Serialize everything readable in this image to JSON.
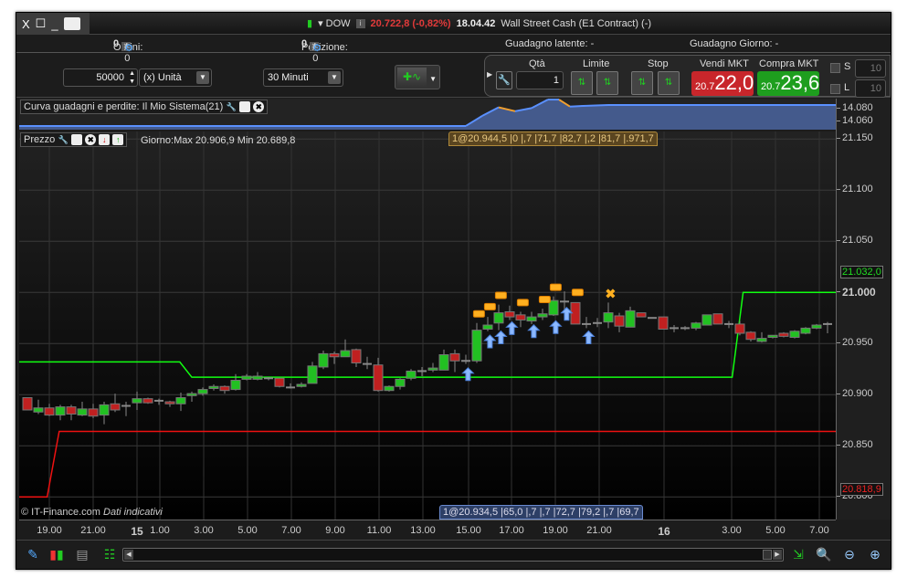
{
  "window": {
    "controls": [
      "X",
      "☐",
      "_"
    ],
    "symbol": "DOW",
    "price": "20.722,8 (-0,82%)",
    "time": "18.04.42",
    "instrument": "Wall Street Cash (E1 Contract) (-)"
  },
  "infobar": {
    "orders_label": "Ordini:",
    "orders_count": "0",
    "orders_sep": "/ 0",
    "position_label": "Posizione:",
    "position_count": "0",
    "position_sep": "/ 0",
    "latent_gain": "Guadagno latente: -",
    "day_gain": "Guadagno Giorno: -"
  },
  "orderbar": {
    "quantity": "50000",
    "unit": "(x) Unità",
    "timeframe": "30 Minuti",
    "qty_label": "Qtà",
    "qty_value": "1",
    "limit_label": "Limite",
    "stop_label": "Stop",
    "sell_label": "Vendi MKT",
    "sell_prefix": "20.7",
    "sell_price": "22,0",
    "buy_label": "Compra MKT",
    "buy_prefix": "20.7",
    "buy_price": "23,6",
    "s_label": "S",
    "s_value": "10",
    "l_label": "L",
    "l_value": "10"
  },
  "colors": {
    "sell": "#c8262b",
    "buy": "#1e9e1e",
    "up": "#22c022",
    "down": "#c02020",
    "equity": "#4a7fd8"
  },
  "equity_panel": {
    "title": "Curva guadagni e perdite: Il Mio Sistema(21)",
    "axis": [
      "14.080",
      "14.060"
    ]
  },
  "price_panel": {
    "title": "Prezzo",
    "day_range": "Giorno:Max 20.906,9 Min 20.689,8",
    "copyright": "© IT-Finance.com",
    "disclaimer": "Dati indicativi",
    "tooltip_top": "1@20.944,5 |0 |,7 |71,7 |82,7 |,2 |81,7 |.971,7",
    "tooltip_bottom": "1@20.934,5 |65,0 |,7 |,7 |72,7 |79,2 |,7 |69,7",
    "marker_green": "21.032,0",
    "marker_red": "20.818,9"
  },
  "chart_data": {
    "type": "candlestick",
    "price_ticks": [
      "21.150",
      "21.100",
      "21.050",
      "21.000",
      "20.950",
      "20.900",
      "20.850",
      "20.800"
    ],
    "tick_values": [
      21150,
      21100,
      21050,
      21000,
      20950,
      20900,
      20850,
      20800
    ],
    "ylim": [
      20790,
      21160
    ],
    "x_ticks": [
      "19.00",
      "21.00",
      "15",
      "1.00",
      "3.00",
      "5.00",
      "7.00",
      "9.00",
      "11.00",
      "13.00",
      "15.00",
      "17.00",
      "19.00",
      "21.00",
      "16",
      "3.00",
      "5.00",
      "7.00"
    ],
    "candles_ohlc": [
      [
        20897,
        20897,
        20885,
        20885
      ],
      [
        20883,
        20895,
        20881,
        20887
      ],
      [
        20887,
        20891,
        20879,
        20880
      ],
      [
        20880,
        20890,
        20875,
        20888
      ],
      [
        20888,
        20890,
        20875,
        20881
      ],
      [
        20880,
        20893,
        20879,
        20886
      ],
      [
        20886,
        20891,
        20877,
        20879
      ],
      [
        20880,
        20893,
        20871,
        20890
      ],
      [
        20891,
        20901,
        20883,
        20885
      ],
      [
        20889,
        20893,
        20879,
        20889
      ],
      [
        20892,
        20903,
        20885,
        20896
      ],
      [
        20896,
        20897,
        20891,
        20892
      ],
      [
        20894,
        20896,
        20890,
        20894
      ],
      [
        20893,
        20894,
        20888,
        20891
      ],
      [
        20891,
        20902,
        20884,
        20897
      ],
      [
        20899,
        20903,
        20893,
        20901
      ],
      [
        20901,
        20907,
        20899,
        20905
      ],
      [
        20906,
        20910,
        20904,
        20908
      ],
      [
        20908,
        20909,
        20901,
        20904
      ],
      [
        20905,
        20920,
        20904,
        20914
      ],
      [
        20915,
        20920,
        20914,
        20918
      ],
      [
        20915,
        20922,
        20914,
        20918
      ],
      [
        20916,
        20917,
        20914,
        20916
      ],
      [
        20916,
        20916,
        20907,
        20908
      ],
      [
        20907,
        20911,
        20906,
        20907
      ],
      [
        20908,
        20912,
        20907,
        20910
      ],
      [
        20911,
        20932,
        20911,
        20928
      ],
      [
        20927,
        20943,
        20925,
        20940
      ],
      [
        20940,
        20942,
        20930,
        20937
      ],
      [
        20937,
        20954,
        20937,
        20943
      ],
      [
        20944,
        20945,
        20927,
        20931
      ],
      [
        20930,
        20937,
        20925,
        20930
      ],
      [
        20929,
        20936,
        20903,
        20904
      ],
      [
        20904,
        20909,
        20903,
        20908
      ],
      [
        20908,
        20916,
        20905,
        20915
      ],
      [
        20916,
        20925,
        20914,
        20923
      ],
      [
        20923,
        20927,
        20918,
        20923
      ],
      [
        20924,
        20931,
        20922,
        20926
      ],
      [
        20924,
        20944,
        20924,
        20939
      ],
      [
        20940,
        20944,
        20922,
        20933
      ],
      [
        20933,
        20939,
        20930,
        20933
      ],
      [
        20933,
        20970,
        20931,
        20963
      ],
      [
        20964,
        20976,
        20962,
        20968
      ],
      [
        20970,
        20988,
        20963,
        20980
      ],
      [
        20981,
        20987,
        20973,
        20976
      ],
      [
        20978,
        20981,
        20966,
        20973
      ],
      [
        20972,
        20981,
        20969,
        20976
      ],
      [
        20976,
        20984,
        20973,
        20979
      ],
      [
        20978,
        20996,
        20977,
        20992
      ],
      [
        20991,
        21001,
        20982,
        20991
      ],
      [
        20990,
        20990,
        20969,
        20969
      ],
      [
        20969,
        20976,
        20965,
        20969
      ],
      [
        20970,
        20975,
        20966,
        20970
      ],
      [
        20971,
        20990,
        20965,
        20980
      ],
      [
        20977,
        20980,
        20961,
        20967
      ],
      [
        20966,
        20986,
        20966,
        20982
      ],
      [
        20980,
        20980,
        20976,
        20976
      ],
      [
        20975,
        20975,
        20975,
        20975
      ],
      [
        20976,
        20976,
        20964,
        20964
      ],
      [
        20965,
        20968,
        20961,
        20965
      ],
      [
        20965,
        20967,
        20963,
        20965
      ],
      [
        20965,
        20971,
        20963,
        20970
      ],
      [
        20968,
        20978,
        20968,
        20978
      ],
      [
        20979,
        20979,
        20969,
        20969
      ],
      [
        20969,
        20972,
        20965,
        20969
      ],
      [
        20969,
        20972,
        20958,
        20960
      ],
      [
        20961,
        20962,
        20952,
        20954
      ],
      [
        20952,
        20961,
        20951,
        20955
      ],
      [
        20956,
        20958,
        20955,
        20958
      ],
      [
        20960,
        20961,
        20956,
        20957
      ],
      [
        20956,
        20963,
        20955,
        20962
      ],
      [
        20960,
        20966,
        20959,
        20965
      ],
      [
        20965,
        20969,
        20964,
        20968
      ],
      [
        20969,
        20971,
        20960,
        20969
      ]
    ],
    "green_line": [
      [
        -1,
        20932
      ],
      [
        13.9,
        20932
      ],
      [
        15,
        20917
      ],
      [
        64.3,
        20917
      ],
      [
        65.3,
        21000
      ],
      [
        74.8,
        21000
      ]
    ],
    "red_line": [
      [
        -1,
        20800
      ],
      [
        1.8,
        20800
      ],
      [
        2.9,
        20864
      ],
      [
        74.8,
        20864
      ]
    ],
    "equity_series": [
      [
        -1,
        14053
      ],
      [
        40,
        14053
      ],
      [
        41.5,
        14066
      ],
      [
        43,
        14077
      ],
      [
        44.5,
        14072
      ],
      [
        46,
        14076
      ],
      [
        47.5,
        14087
      ],
      [
        48.5,
        14087
      ],
      [
        49.5,
        14078
      ],
      [
        51,
        14079
      ],
      [
        53,
        14080
      ],
      [
        74.8,
        14080
      ]
    ],
    "equity_ylim": [
      14050,
      14090
    ],
    "buy_arrows": [
      [
        40.2,
        20920
      ],
      [
        42.2,
        20952
      ],
      [
        43.2,
        20956
      ],
      [
        44.2,
        20965
      ],
      [
        46.2,
        20962
      ],
      [
        48.2,
        20966
      ],
      [
        49.2,
        20979
      ],
      [
        51.2,
        20956
      ]
    ],
    "orders": [
      [
        41.2,
        20979
      ],
      [
        42.2,
        20986
      ],
      [
        43.2,
        20997
      ],
      [
        45.2,
        20990
      ],
      [
        47.2,
        20993
      ],
      [
        48.2,
        21005
      ],
      [
        50.2,
        21000
      ]
    ],
    "cancel_marks": [
      [
        53.2,
        20999
      ]
    ]
  },
  "toolbar": {
    "icons": [
      "draw-tool",
      "candle-type",
      "indicators",
      "order-book",
      "scroll-left",
      "scroll-right",
      "autoscale",
      "zoom-vertical",
      "zoom-out",
      "zoom-in"
    ]
  }
}
